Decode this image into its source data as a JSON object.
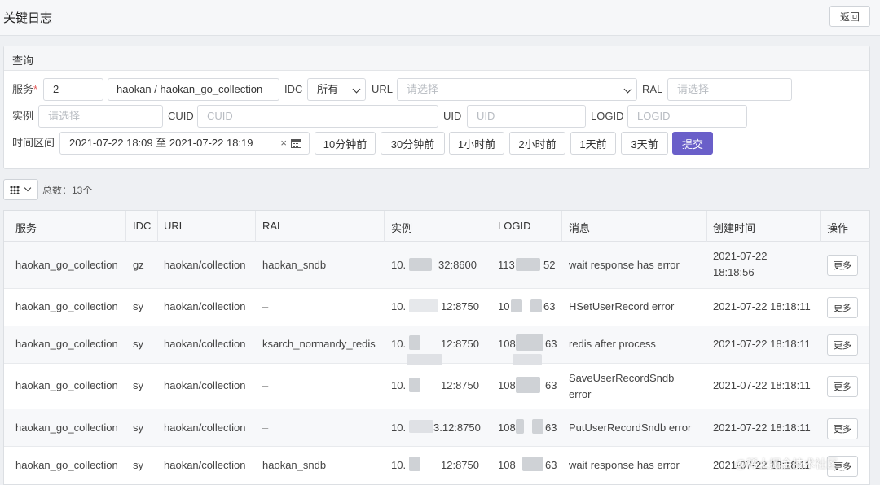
{
  "page": {
    "title": "关键日志",
    "back_label": "返回"
  },
  "query": {
    "header": "查询",
    "service_label": "服务",
    "required_mark": "*",
    "service_id": "2",
    "service_name": "haokan / haokan_go_collection",
    "idc_label": "IDC",
    "idc_value": "所有",
    "url_label": "URL",
    "url_placeholder": "请选择",
    "ral_label": "RAL",
    "ral_placeholder": "请选择",
    "instance_label": "实例",
    "instance_placeholder": "请选择",
    "cuid_label": "CUID",
    "cuid_placeholder": "CUID",
    "uid_label": "UID",
    "uid_placeholder": "UID",
    "logid_label": "LOGID",
    "logid_placeholder": "LOGID",
    "time_label": "时间区间",
    "time_range": "2021-07-22 18:09 至 2021-07-22 18:19",
    "clear_glyph": "×",
    "quick_ranges": [
      "10分钟前",
      "30分钟前",
      "1小时前",
      "2小时前",
      "1天前",
      "3天前"
    ],
    "submit_label": "提交"
  },
  "toolbar": {
    "total_text": "总数：13个"
  },
  "table": {
    "columns": [
      "服务",
      "IDC",
      "URL",
      "RAL",
      "实例",
      "LOGID",
      "消息",
      "创建时间",
      "操作"
    ],
    "more_label": "更多",
    "rows": [
      {
        "service": "haokan_go_collection",
        "idc": "gz",
        "url": "haokan/collection",
        "ral": "haokan_sndb",
        "inst_a": "10.",
        "inst_b": "32:8600",
        "logid_a": "113",
        "logid_b": "52",
        "msg1": "wait response has error",
        "msg2": "",
        "time1": "2021-07-22",
        "time2": "18:18:56"
      },
      {
        "service": "haokan_go_collection",
        "idc": "sy",
        "url": "haokan/collection",
        "ral": "–",
        "inst_a": "10.",
        "inst_b": "12:8750",
        "logid_a": "10",
        "logid_b": "63",
        "msg1": "HSetUserRecord error",
        "msg2": "",
        "time1": "2021-07-22 18:18:11",
        "time2": ""
      },
      {
        "service": "haokan_go_collection",
        "idc": "sy",
        "url": "haokan/collection",
        "ral": "ksarch_normandy_redis",
        "inst_a": "10.",
        "inst_b": "12:8750",
        "logid_a": "108",
        "logid_b": "63",
        "msg1": "redis after process",
        "msg2": "",
        "time1": "2021-07-22 18:18:11",
        "time2": ""
      },
      {
        "service": "haokan_go_collection",
        "idc": "sy",
        "url": "haokan/collection",
        "ral": "–",
        "inst_a": "10.",
        "inst_b": "12:8750",
        "logid_a": "108",
        "logid_b": "63",
        "msg1": "SaveUserRecordSndb",
        "msg2": "error",
        "time1": "2021-07-22 18:18:11",
        "time2": ""
      },
      {
        "service": "haokan_go_collection",
        "idc": "sy",
        "url": "haokan/collection",
        "ral": "–",
        "inst_a": "10.",
        "inst_b": "3.12:8750",
        "logid_a": "108",
        "logid_b": "63",
        "msg1": "PutUserRecordSndb error",
        "msg2": "",
        "time1": "2021-07-22 18:18:11",
        "time2": ""
      },
      {
        "service": "haokan_go_collection",
        "idc": "sy",
        "url": "haokan/collection",
        "ral": "haokan_sndb",
        "inst_a": "10.",
        "inst_b": "12:8750",
        "logid_a": "108",
        "logid_b": "63",
        "msg1": "wait response has error",
        "msg2": "",
        "time1": "2021-07-22 18:18:11",
        "time2": ""
      }
    ]
  },
  "watermark": "@稀土掘金技术社区"
}
